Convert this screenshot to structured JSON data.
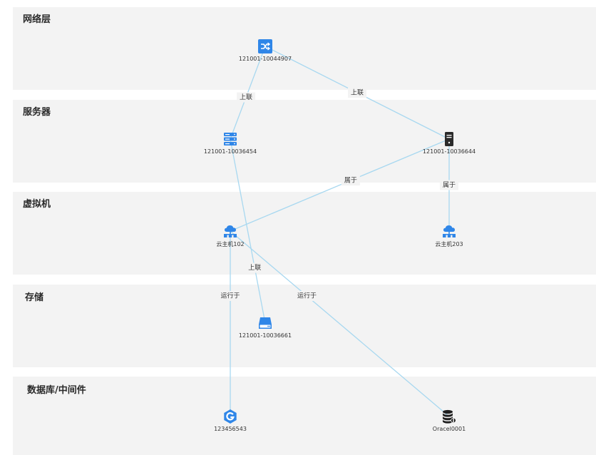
{
  "layers": [
    {
      "id": "network",
      "title": "网络层"
    },
    {
      "id": "server",
      "title": "服务器"
    },
    {
      "id": "vm",
      "title": "虚拟机"
    },
    {
      "id": "storage",
      "title": "存储"
    },
    {
      "id": "db",
      "title": "数据库/中间件"
    }
  ],
  "nodes": {
    "switch": {
      "label": "121001-10044907",
      "icon": "switch-icon"
    },
    "server_a": {
      "label": "121001-10036454",
      "icon": "server-rack-icon"
    },
    "server_b": {
      "label": "121001-10036644",
      "icon": "server-tower-icon"
    },
    "vm_102": {
      "label": "云主机102",
      "icon": "cloud-host-icon"
    },
    "vm_203": {
      "label": "云主机203",
      "icon": "cloud-host-icon"
    },
    "disk": {
      "label": "121001-10036661",
      "icon": "disk-icon"
    },
    "middleware": {
      "label": "123456543",
      "icon": "middleware-icon"
    },
    "oracle": {
      "label": "Oracel0001",
      "icon": "database-icon"
    }
  },
  "edges": [
    {
      "from": "switch",
      "to": "server_a",
      "label": "上联"
    },
    {
      "from": "switch",
      "to": "server_b",
      "label": "上联"
    },
    {
      "from": "server_a",
      "to": "disk",
      "label": "上联"
    },
    {
      "from": "server_b",
      "to": "vm_102",
      "label": "属于"
    },
    {
      "from": "server_b",
      "to": "vm_203",
      "label": "属于"
    },
    {
      "from": "vm_102",
      "to": "middleware",
      "label": "运行于"
    },
    {
      "from": "vm_102",
      "to": "oracle",
      "label": "运行于"
    }
  ],
  "colors": {
    "blue": "#2f86e8",
    "dark": "#2b2b2b",
    "edge": "#a8d8f0",
    "layer_bg": "#f3f3f3"
  }
}
